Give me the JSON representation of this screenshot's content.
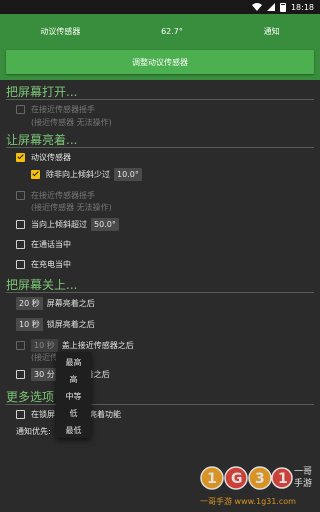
{
  "status_bar": {
    "time": "18:18",
    "icons": [
      "wifi-icon",
      "signal-icon",
      "battery-icon"
    ]
  },
  "header": {
    "motion_sensor_label": "动议传感器",
    "angle_value": "62.7°",
    "notify_label": "通知",
    "calibrate_button": "调整动议传感器"
  },
  "section_turn_on": {
    "title": "把屏幕打开...",
    "proximity_label": "在接近传感器摇手",
    "proximity_subtext": "(接近传感器 无法操作)"
  },
  "section_keep_on": {
    "title": "让屏幕亮着...",
    "motion_sensor_label": "动议传感器",
    "tilt_label": "除非向上倾斜少过",
    "tilt_value": "10.0°",
    "proximity_label": "在接近传感器摇手",
    "proximity_subtext": "(接近传感器 无法操作)",
    "tilt_up_label": "当向上倾斜超过",
    "tilt_up_value": "50.0°",
    "in_call_label": "在通话当中",
    "charging_label": "在充电当中"
  },
  "section_turn_off": {
    "title": "把屏幕关上...",
    "screen_on_value": "20 秒",
    "screen_on_label": "屏幕亮着之后",
    "lock_value": "10 秒",
    "lock_label": "锁屏亮着之后",
    "proximity_value": "10 秒",
    "proximity_label": "盖上接近传感器之后",
    "proximity_subtext": "(接近传",
    "timeout_value": "30 分",
    "timeout_label": "着之后"
  },
  "section_more": {
    "title": "更多选项",
    "lock_screen_label": "在锁屏",
    "lock_screen_suffix": "亮着功能",
    "notify_priority_label": "通知优先:"
  },
  "popup": {
    "options": [
      "最高",
      "高",
      "中等",
      "低",
      "最低"
    ]
  },
  "watermark": {
    "logo_text": "1G31",
    "brand_text": "一哥手游",
    "url_text": "一哥手游 www.1g31.com"
  }
}
